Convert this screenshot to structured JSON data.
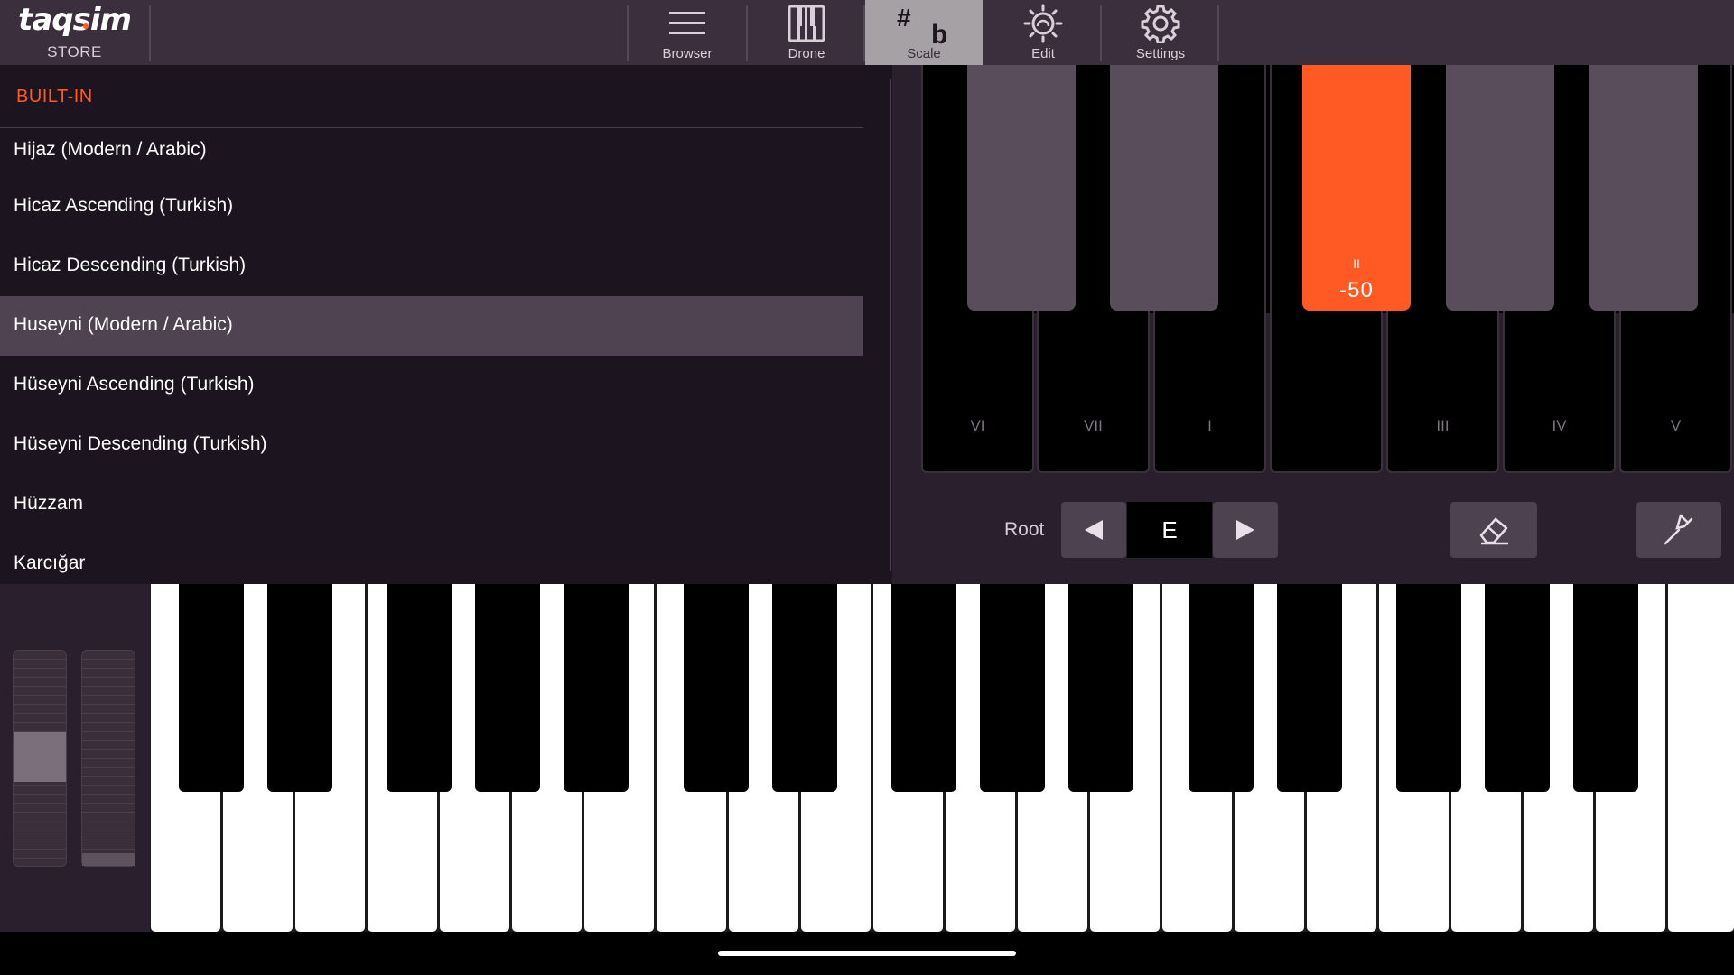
{
  "brand": {
    "logo": "taqsim",
    "store": "STORE"
  },
  "tabs": [
    {
      "label": "Browser",
      "icon": "hamburger-icon",
      "active": false
    },
    {
      "label": "Drone",
      "icon": "piano-icon",
      "active": false
    },
    {
      "label": "Scale",
      "icon": "sharp-flat-icon",
      "active": true,
      "sharp": "#",
      "flat": "b"
    },
    {
      "label": "Edit",
      "icon": "sun-gear-icon",
      "active": false
    },
    {
      "label": "Settings",
      "icon": "gear-icon",
      "active": false
    }
  ],
  "scale_list": {
    "section_header": "BUILT-IN",
    "items": [
      {
        "label": "Hijaz (Modern / Arabic)",
        "selected": false
      },
      {
        "label": "Hicaz Ascending (Turkish)",
        "selected": false
      },
      {
        "label": "Hicaz Descending (Turkish)",
        "selected": false
      },
      {
        "label": "Huseyni (Modern / Arabic)",
        "selected": true
      },
      {
        "label": "Hüseyni Ascending (Turkish)",
        "selected": false
      },
      {
        "label": "Hüseyni Descending (Turkish)",
        "selected": false
      },
      {
        "label": "Hüzzam",
        "selected": false
      },
      {
        "label": "Karcığar",
        "selected": false
      }
    ]
  },
  "scale_editor": {
    "degrees": [
      "VI",
      "VII",
      "I",
      "",
      "III",
      "IV",
      "V"
    ],
    "active_accidental": {
      "marker": "II",
      "cents": "-50"
    },
    "root_label": "Root",
    "root_value": "E"
  },
  "colors": {
    "accent": "#ff5a24",
    "topbar": "#3c2f3d",
    "panel": "#1c141e"
  }
}
